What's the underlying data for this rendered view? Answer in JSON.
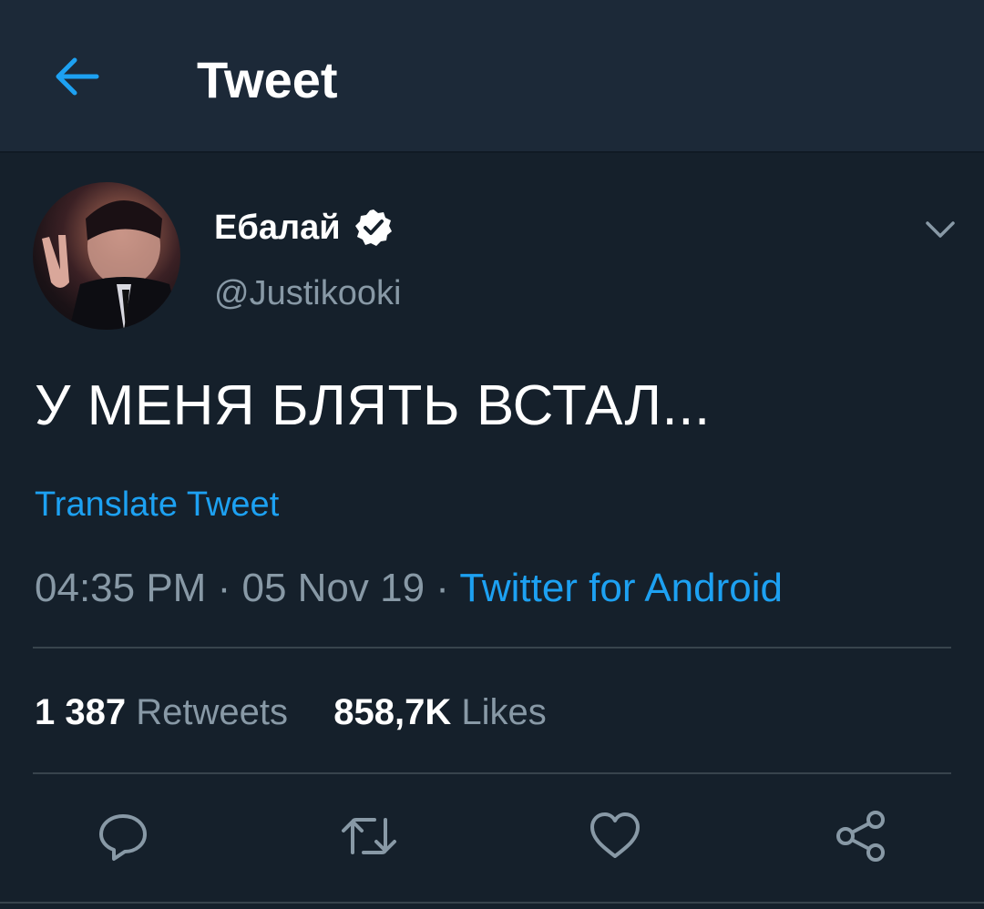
{
  "header": {
    "title": "Tweet",
    "back_icon": "arrow-left-icon"
  },
  "author": {
    "display_name": "Ебалай",
    "handle": "@Justikooki",
    "verified_icon": "verified-badge-icon"
  },
  "tweet": {
    "text": "У МЕНЯ БЛЯТЬ ВСТАЛ...",
    "translate_label": "Translate Tweet",
    "time": "04:35 PM",
    "date": "05 Nov 19",
    "separator": "·",
    "source": "Twitter for Android"
  },
  "stats": {
    "retweets_count": "1 387",
    "retweets_label": "Retweets",
    "likes_count": "858,7K",
    "likes_label": "Likes"
  },
  "actions": {
    "reply_icon": "reply-icon",
    "retweet_icon": "retweet-icon",
    "like_icon": "heart-icon",
    "share_icon": "share-icon"
  },
  "colors": {
    "background": "#15202b",
    "header_bg": "#1c2938",
    "accent": "#1da1f2",
    "secondary_text": "#8899a6",
    "divider": "#38444d"
  }
}
